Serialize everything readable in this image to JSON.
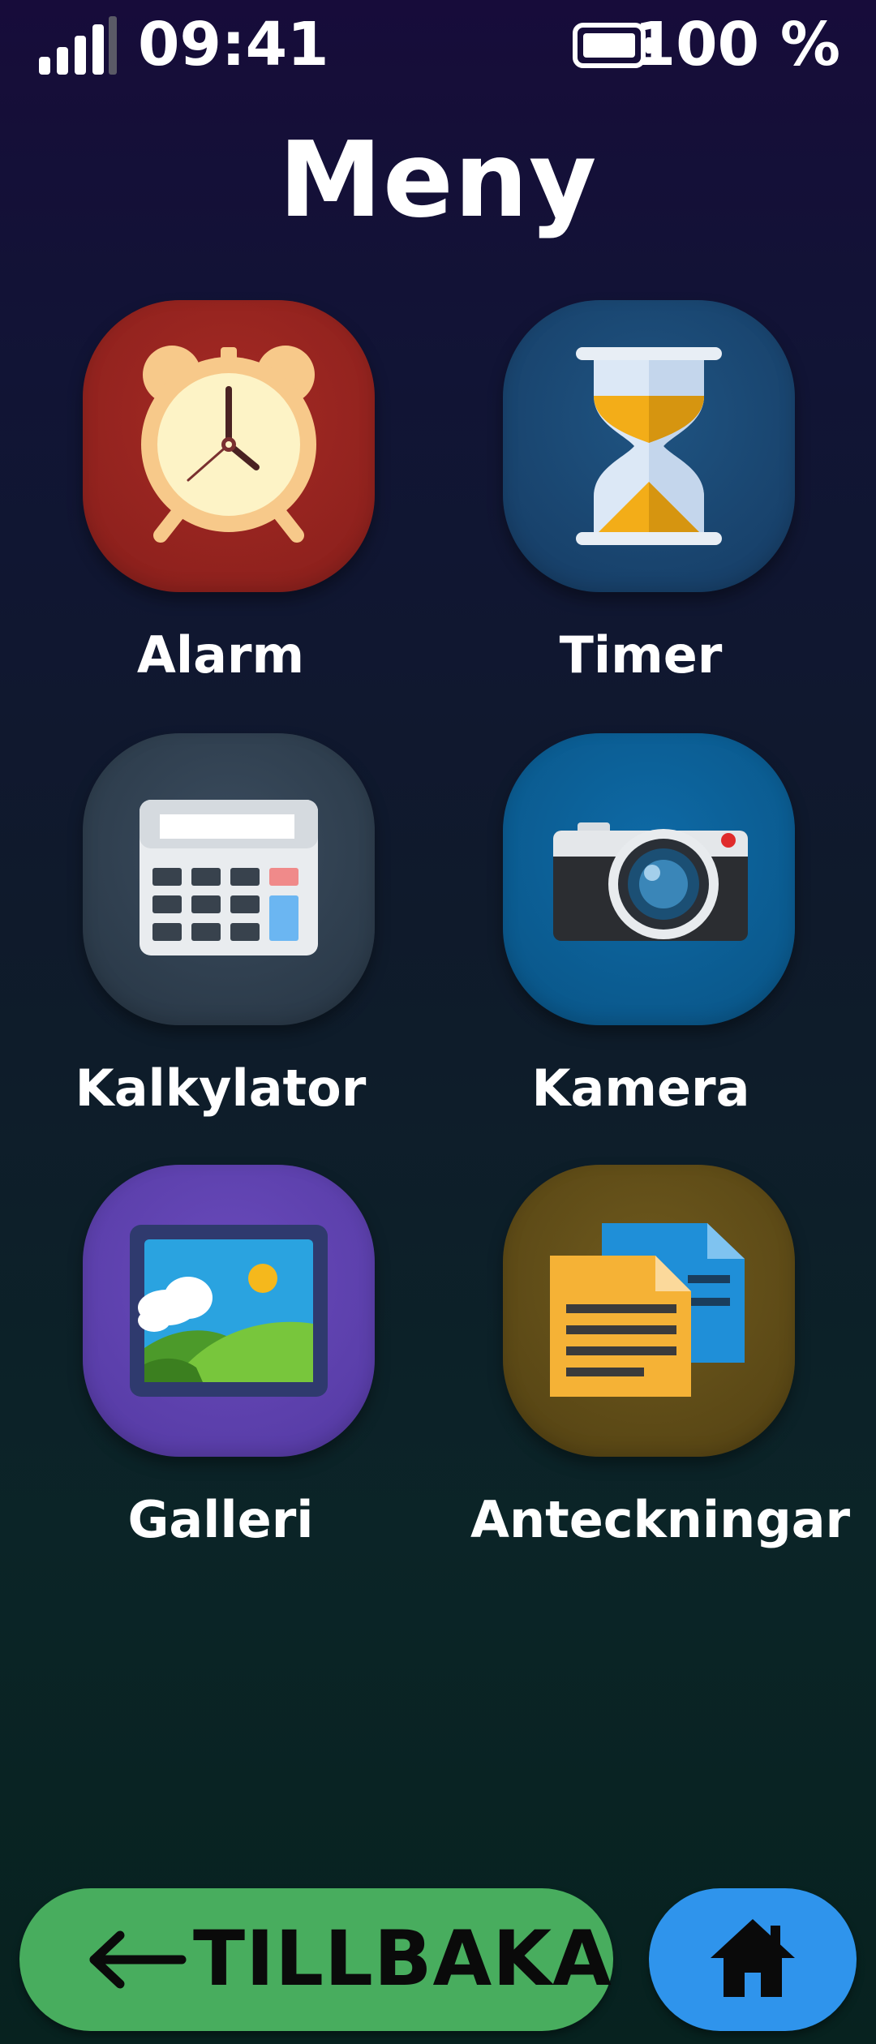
{
  "status_bar": {
    "time": "09:41",
    "battery_text": "100 %",
    "signal_icon": "signal-bars-icon",
    "battery_icon": "battery-full-icon"
  },
  "header": {
    "title": "Meny"
  },
  "apps": [
    {
      "label": "Alarm",
      "icon": "alarm-clock-icon",
      "color": "#9b2621"
    },
    {
      "label": "Timer",
      "icon": "hourglass-icon",
      "color": "#1b4a76"
    },
    {
      "label": "Kalkylator",
      "icon": "calculator-icon",
      "color": "#33424f"
    },
    {
      "label": "Kamera",
      "icon": "camera-icon",
      "color": "#0c619a"
    },
    {
      "label": "Galleri",
      "icon": "picture-icon",
      "color": "#6144b1"
    },
    {
      "label": "Anteckningar",
      "icon": "notes-icon",
      "color": "#654f18"
    }
  ],
  "footer": {
    "back_label": "TILLBAKA",
    "back_icon": "arrow-left-icon",
    "back_color": "#48ad5e",
    "home_icon": "home-icon",
    "home_color": "#2f94ec"
  }
}
